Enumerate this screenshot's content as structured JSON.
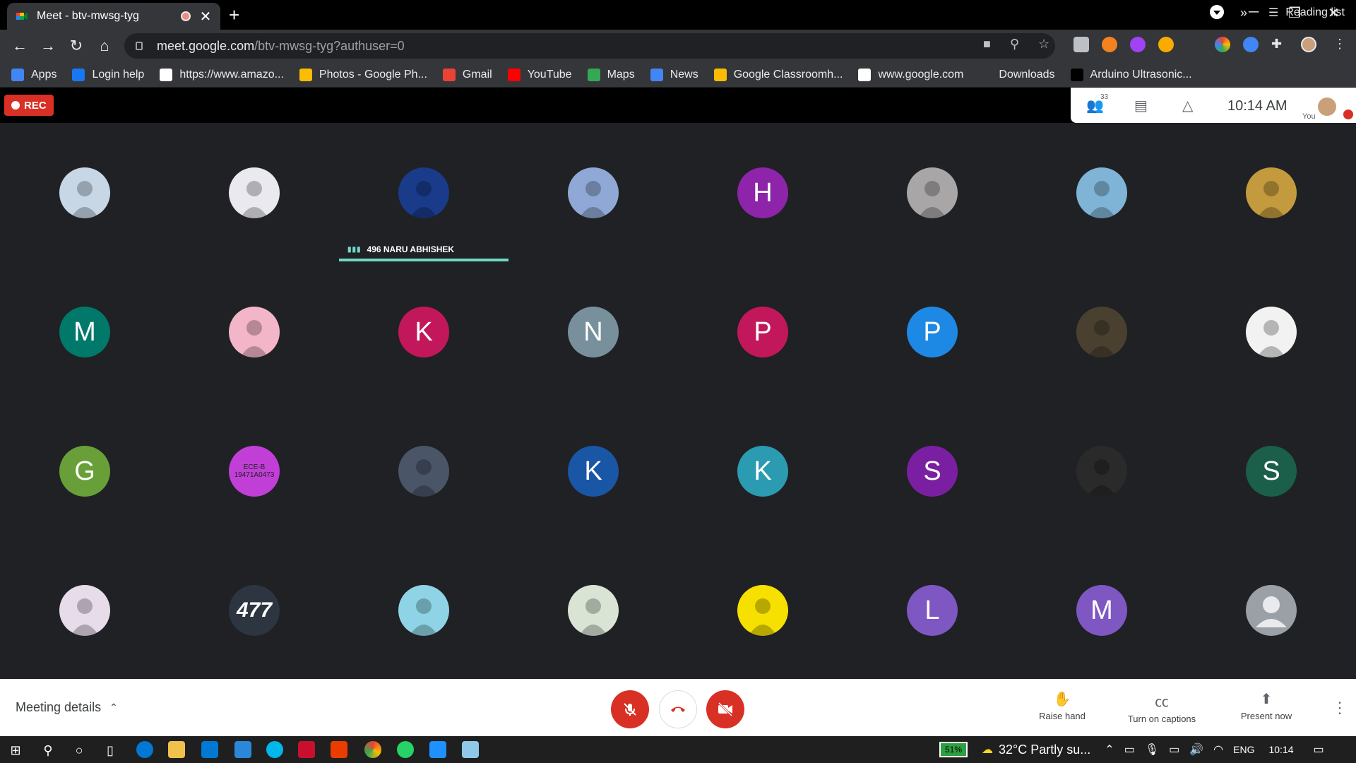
{
  "tab": {
    "title": "Meet - btv-mwsg-tyg",
    "close": "✕",
    "new_tab": "+"
  },
  "window": {
    "minimize": "─",
    "restore": "❐",
    "close": "✕"
  },
  "toolbar": {
    "back": "←",
    "forward": "→",
    "reload": "↻",
    "home": "⌂",
    "url_host": "meet.google.com",
    "url_path": "/btv-mwsg-tyg?authuser=0"
  },
  "bookmarks": [
    {
      "label": "Apps",
      "icon": "apps-grid-icon",
      "color": "#4285f4"
    },
    {
      "label": "Login help",
      "icon": "facebook-icon",
      "color": "#1877f2"
    },
    {
      "label": "https://www.amazo...",
      "icon": "amazon-icon",
      "color": "#ffffff"
    },
    {
      "label": "Photos - Google Ph...",
      "icon": "google-photos-icon",
      "color": "#fbbc04"
    },
    {
      "label": "Gmail",
      "icon": "gmail-icon",
      "color": "#ea4335"
    },
    {
      "label": "YouTube",
      "icon": "youtube-icon",
      "color": "#ff0000"
    },
    {
      "label": "Maps",
      "icon": "maps-icon",
      "color": "#34a853"
    },
    {
      "label": "News",
      "icon": "news-icon",
      "color": "#4285f4"
    },
    {
      "label": "Google Classroomh...",
      "icon": "classroom-icon",
      "color": "#fbbc04"
    },
    {
      "label": "www.google.com",
      "icon": "google-icon",
      "color": "#ffffff"
    },
    {
      "label": "Downloads",
      "icon": "download-icon",
      "color": "#35363a"
    },
    {
      "label": "Arduino Ultrasonic...",
      "icon": "arduino-icon",
      "color": "#000000"
    }
  ],
  "bookmarks_more": "»",
  "reading_list": "Reading list",
  "meet": {
    "rec_label": "REC",
    "participants_count": "33",
    "time": "10:14 AM",
    "you_label": "You",
    "active_speaker": "496 NARU ABHISHEK"
  },
  "participants": [
    {
      "initial": "",
      "color": "#c7d7e6",
      "kind": "photo"
    },
    {
      "initial": "",
      "color": "#e9e9ef",
      "kind": "photo"
    },
    {
      "initial": "",
      "color": "#1a3a8a",
      "kind": "photo"
    },
    {
      "initial": "",
      "color": "#8fa8d6",
      "kind": "photo"
    },
    {
      "initial": "H",
      "color": "#8e24aa",
      "kind": "letter"
    },
    {
      "initial": "",
      "color": "#a9a6a7",
      "kind": "photo"
    },
    {
      "initial": "",
      "color": "#7fb4d6",
      "kind": "photo"
    },
    {
      "initial": "",
      "color": "#c39a3e",
      "kind": "photo"
    },
    {
      "initial": "M",
      "color": "#00796b",
      "kind": "letter"
    },
    {
      "initial": "",
      "color": "#f3b6c8",
      "kind": "photo"
    },
    {
      "initial": "K",
      "color": "#c2185b",
      "kind": "letter"
    },
    {
      "initial": "N",
      "color": "#78909c",
      "kind": "letter"
    },
    {
      "initial": "P",
      "color": "#c2185b",
      "kind": "letter"
    },
    {
      "initial": "P",
      "color": "#1e88e5",
      "kind": "letter"
    },
    {
      "initial": "",
      "color": "#4a4030",
      "kind": "photo"
    },
    {
      "initial": "",
      "color": "#f2f2f2",
      "kind": "photo"
    },
    {
      "initial": "G",
      "color": "#689f38",
      "kind": "letter"
    },
    {
      "initial": "ECE-B 19471A0473",
      "color": "#c13fd6",
      "kind": "text"
    },
    {
      "initial": "",
      "color": "#4a5568",
      "kind": "photo"
    },
    {
      "initial": "K",
      "color": "#1a56a6",
      "kind": "letter"
    },
    {
      "initial": "K",
      "color": "#2b9bb2",
      "kind": "letter"
    },
    {
      "initial": "S",
      "color": "#7b1fa2",
      "kind": "letter"
    },
    {
      "initial": "",
      "color": "#2a2a2a",
      "kind": "photo"
    },
    {
      "initial": "S",
      "color": "#1b5e4a",
      "kind": "letter"
    },
    {
      "initial": "",
      "color": "#e6dcea",
      "kind": "photo"
    },
    {
      "initial": "477",
      "color": "#2c3540",
      "kind": "text"
    },
    {
      "initial": "",
      "color": "#8ed4e6",
      "kind": "photo"
    },
    {
      "initial": "",
      "color": "#d9e4d4",
      "kind": "photo"
    },
    {
      "initial": "",
      "color": "#f5e000",
      "kind": "photo"
    },
    {
      "initial": "L",
      "color": "#7e57c2",
      "kind": "letter"
    },
    {
      "initial": "M",
      "color": "#7e57c2",
      "kind": "letter"
    },
    {
      "initial": "",
      "color": "#9aa0a6",
      "kind": "default"
    }
  ],
  "controls": {
    "meeting_details": "Meeting details",
    "raise_hand": "Raise hand",
    "captions": "Turn on captions",
    "present": "Present now"
  },
  "taskbar": {
    "battery": "51%",
    "weather": "32°C  Partly su...",
    "lang": "ENG",
    "time": "10:14"
  }
}
